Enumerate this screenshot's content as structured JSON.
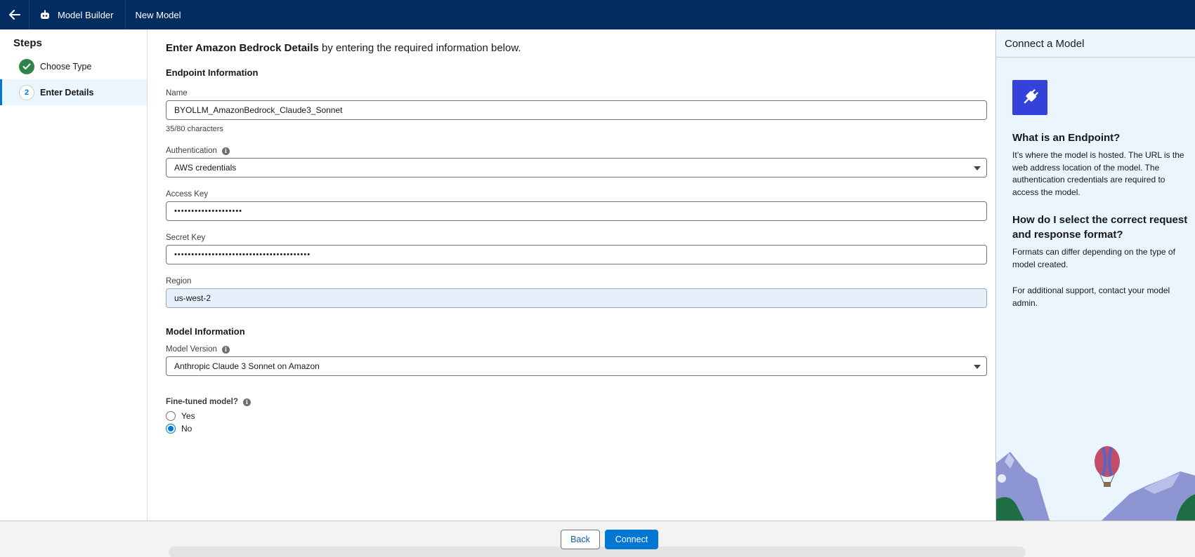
{
  "header": {
    "app_name": "Model Builder",
    "page_name": "New Model"
  },
  "steps": {
    "title": "Steps",
    "items": [
      {
        "label": "Choose Type",
        "state": "complete"
      },
      {
        "label": "Enter Details",
        "number": "2",
        "state": "current"
      }
    ]
  },
  "form": {
    "heading_bold": "Enter Amazon Bedrock Details",
    "heading_rest": " by entering the required information below.",
    "endpoint_section": "Endpoint Information",
    "name_label": "Name",
    "name_value": "BYOLLM_AmazonBedrock_Claude3_Sonnet",
    "name_char_count": "35/80 characters",
    "auth_label": "Authentication",
    "auth_value": "AWS credentials",
    "access_key_label": "Access Key",
    "access_key_value": "••••••••••••••••••••",
    "secret_key_label": "Secret Key",
    "secret_key_value": "••••••••••••••••••••••••••••••••••••••••",
    "region_label": "Region",
    "region_value": "us-west-2",
    "model_section": "Model Information",
    "model_version_label": "Model Version",
    "model_version_value": "Anthropic Claude 3 Sonnet on Amazon",
    "fine_tuned_label": "Fine-tuned model?",
    "fine_tuned_options": [
      {
        "label": "Yes",
        "selected": false
      },
      {
        "label": "No",
        "selected": true
      }
    ]
  },
  "help": {
    "title": "Connect a Model",
    "q1": "What is an Endpoint?",
    "a1": "It’s where the model is hosted. The URL is the web address location of the model. The authentication credentials are required to access the model.",
    "q2": "How do I select the correct request and response format?",
    "a2": "Formats can differ depending on the type of model created.",
    "support": "For additional support, contact your model admin."
  },
  "footer": {
    "back_label": "Back",
    "connect_label": "Connect"
  },
  "colors": {
    "header_bg": "#032d60",
    "brand": "#0176d3",
    "success": "#2e844a",
    "help_bg": "#eaf5fe",
    "help_tile": "#3442d9"
  },
  "icons": {
    "back": "arrow-left-icon",
    "app": "robot-icon",
    "complete_step": "check-icon",
    "info": "info-icon",
    "dropdown": "caret-down-icon",
    "help_tile": "plug-icon"
  }
}
